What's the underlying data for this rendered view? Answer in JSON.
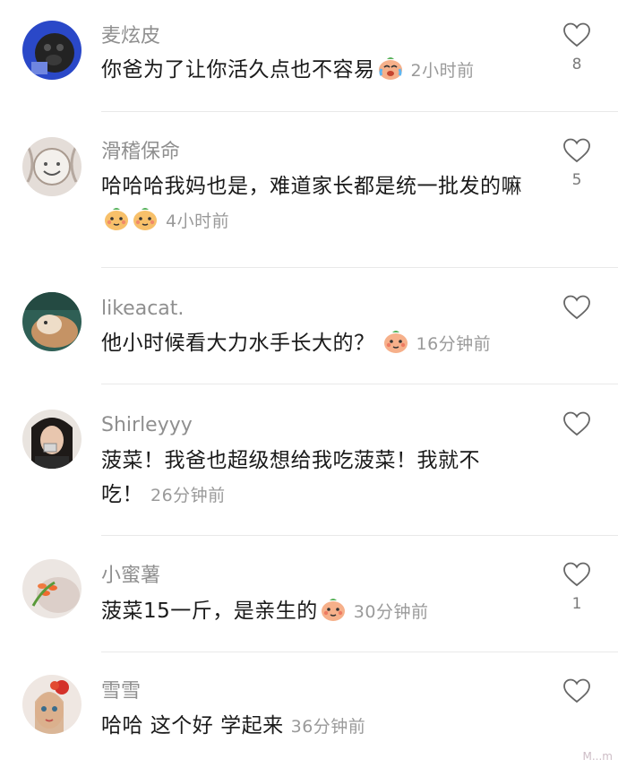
{
  "comments": [
    {
      "username": "麦炫皮",
      "text": "你爸为了让你活久点也不容易",
      "emoji_icons": [
        "crying-laughing-peach-icon"
      ],
      "time": "2小时前",
      "likes": "8"
    },
    {
      "username": "滑稽保命",
      "text": "哈哈哈我妈也是，难道家长都是统一批发的嘛",
      "emoji_icons": [
        "peach-face-icon",
        "peach-face-icon"
      ],
      "time": "4小时前",
      "likes": "5"
    },
    {
      "username": "likeacat.",
      "text": "他小时候看大力水手长大的？",
      "emoji_icons": [
        "peach-face-icon"
      ],
      "time": "16分钟前",
      "likes": ""
    },
    {
      "username": "Shirleyyy",
      "text": "菠菜！我爸也超级想给我吃菠菜！我就不吃！",
      "emoji_icons": [],
      "time": "26分钟前",
      "likes": ""
    },
    {
      "username": "小蜜薯",
      "text": "菠菜15一斤，是亲生的",
      "emoji_icons": [
        "peach-face-icon"
      ],
      "time": "30分钟前",
      "likes": "1"
    },
    {
      "username": "雪雪",
      "text": "哈哈 这个好 学起来",
      "emoji_icons": [],
      "time": "36分钟前",
      "likes": ""
    }
  ],
  "watermark": "M...m",
  "colors": {
    "username": "#8f8f8f",
    "time": "#9a9a9a",
    "divider": "#e9e9e9",
    "peach": "#f6b08a"
  }
}
